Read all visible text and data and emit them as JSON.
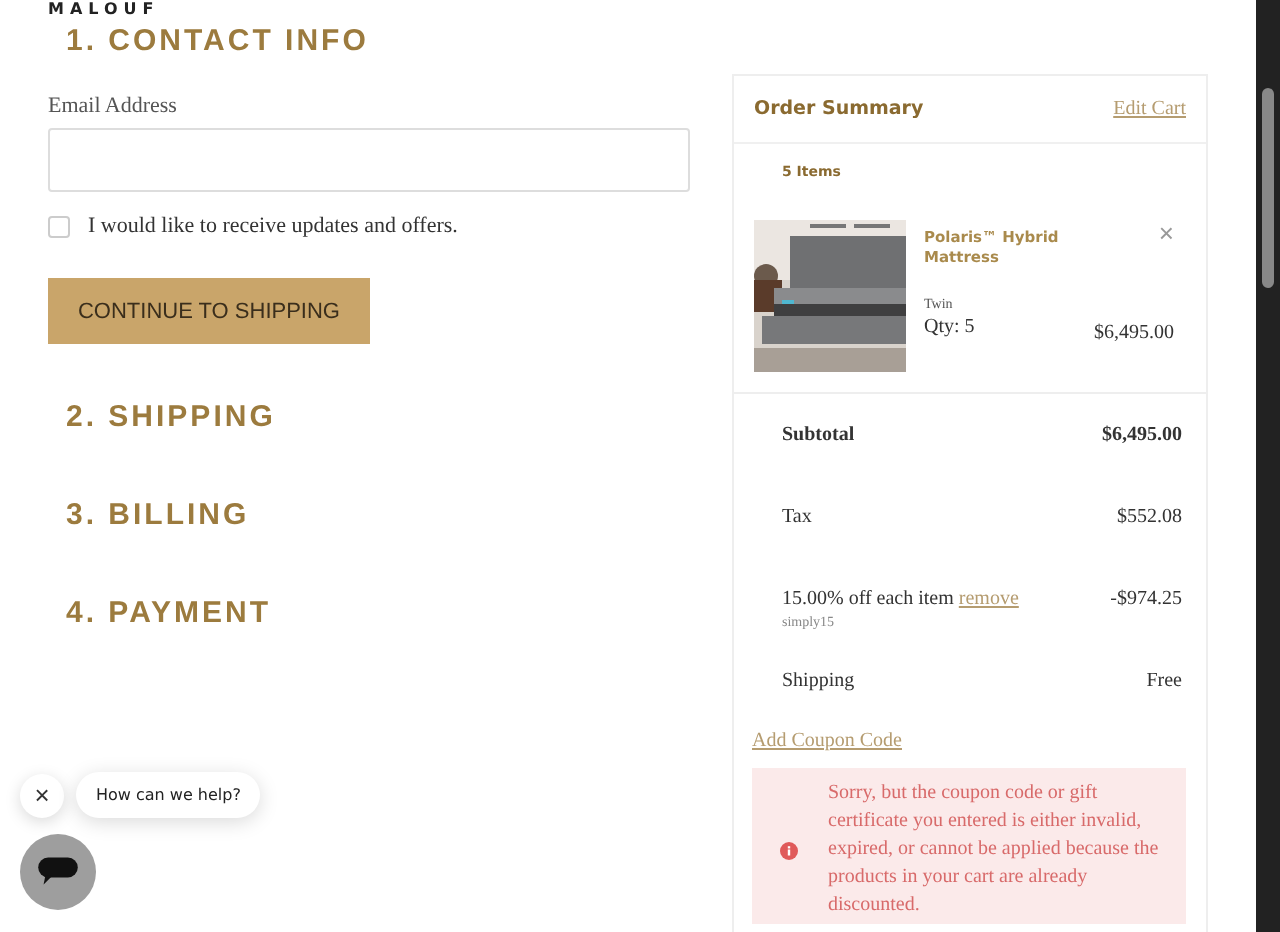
{
  "logo": "MALOUF",
  "sections": [
    {
      "title": "1. CONTACT INFO"
    },
    {
      "title": "2. SHIPPING"
    },
    {
      "title": "3. BILLING"
    },
    {
      "title": "4. PAYMENT"
    }
  ],
  "contact": {
    "email_label": "Email Address",
    "updates": {
      "label": "I would like to receive updates and offers.",
      "checked": false
    },
    "continue_button": "CONTINUE TO SHIPPING"
  },
  "order_summary": {
    "title": "Order Summary",
    "edit_link": "Edit Cart",
    "item_count": "5 Items",
    "items": [
      {
        "name": "Polaris™ Hybrid Mattress",
        "variant": "Twin",
        "qty": "Qty: 5",
        "price": "$6,495.00",
        "remove": "×"
      }
    ],
    "totals": [
      {
        "label": "Subtotal",
        "value": "$6,495.00",
        "kind": "bold"
      },
      {
        "label": "Tax",
        "value": "$552.08",
        "kind": "plain"
      },
      {
        "label": "15.00% off each item",
        "link": "remove",
        "code": "simply15",
        "value": "-$974.25",
        "kind": "discount"
      },
      {
        "label": "Shipping",
        "value": "Free",
        "kind": "plain"
      }
    ],
    "coupon_link": "Add Coupon Code",
    "error": "Sorry, but the coupon code or gift certificate you entered is either invalid, expired, or cannot be applied because the products in your cart are already discounted."
  },
  "chat": {
    "prompt": "How can we help?",
    "close": "×"
  }
}
